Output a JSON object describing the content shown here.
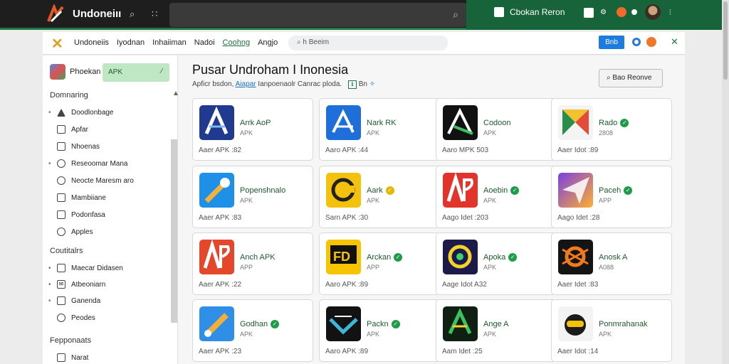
{
  "topbar": {
    "brand": "Undoneiıı",
    "search_placeholder": "",
    "ext_button": "Cbokan Reron",
    "accent": "#17643a"
  },
  "navbar": {
    "menu": [
      "Undoneiis",
      "Iyodnan",
      "Inhaiiman",
      "Nadoi",
      "Coohng",
      "Angjo"
    ],
    "active_index": 4,
    "search_placeholder": "h Beeim",
    "button": "Bnb"
  },
  "sidebar": {
    "app_name": "Phoekan",
    "apk_label": "APK",
    "sections": [
      {
        "label": "Domnaring",
        "items": [
          "Doodlonbage",
          "Apfar",
          "Nhoenas",
          "Reseoomar Mana",
          "Neocte Maresm aro",
          "Mambiiane",
          "Podonfasa",
          "Apples"
        ]
      },
      {
        "label": "Coutitalrs",
        "items": [
          "Maecar Didasen",
          "Atbeoniarn",
          "Ganenda",
          "Peodes"
        ]
      },
      {
        "label": "Fepponaats",
        "items": [
          "Narat"
        ]
      }
    ]
  },
  "main": {
    "title": "Pusar Undroham I Inonesia",
    "subtitle_text": "Apficr bsdon,",
    "subtitle_link": "Aiapar",
    "subtitle_rest": "Ianpoenaolr Canrac ploda.",
    "subtitle_icon": "Bn",
    "search_button": "Bao Reonve",
    "cards": [
      {
        "name": "Arrk AoP",
        "sub": "APK",
        "meta": "Aaer APK :82",
        "check": false,
        "icon": "a-blue"
      },
      {
        "name": "Nark RK",
        "sub": "APK",
        "meta": "Aaro APK :44",
        "check": false,
        "icon": "a-bright"
      },
      {
        "name": "Codoon",
        "sub": "APK",
        "meta": "Aaro MPK 503",
        "check": false,
        "icon": "a-black"
      },
      {
        "name": "Rado",
        "sub": "2808",
        "meta": "Aaer Idot :89",
        "check": "green",
        "icon": "x-colorful"
      },
      {
        "name": "Popenshnalo",
        "sub": "APK",
        "meta": "Aaer APK :83",
        "check": false,
        "icon": "wrench-blue"
      },
      {
        "name": "Aark",
        "sub": "APK",
        "meta": "Sarn APK :30",
        "check": "yellow",
        "icon": "c-yellow"
      },
      {
        "name": "Aoebin",
        "sub": "APK",
        "meta": "Aago Idet :203",
        "check": "green",
        "icon": "ap-red"
      },
      {
        "name": "Paceh",
        "sub": "APP",
        "meta": "Aago Idet :28",
        "check": "green",
        "icon": "paper-plane"
      },
      {
        "name": "Anch APK",
        "sub": "APP",
        "meta": "Aaer APK :22",
        "check": false,
        "icon": "ap-orange"
      },
      {
        "name": "Arckan",
        "sub": "APP",
        "meta": "Aaro APK :89",
        "check": "green",
        "icon": "fd-yellow"
      },
      {
        "name": "Apoka",
        "sub": "APK",
        "meta": "Aage Idot A32",
        "check": "green",
        "icon": "swirl-dark"
      },
      {
        "name": "Anosk A",
        "sub": "A088",
        "meta": "Aaer Idet :83",
        "check": false,
        "icon": "ox-orange"
      },
      {
        "name": "Godhan",
        "sub": "APK",
        "meta": "Aaer APK :23",
        "check": "green",
        "icon": "tool-blue"
      },
      {
        "name": "Packn",
        "sub": "APK",
        "meta": "Aaro APK :89",
        "check": "green",
        "icon": "wing-dark"
      },
      {
        "name": "Ange A",
        "sub": "APK",
        "meta": "Aam Idet :25",
        "check": false,
        "icon": "a-dark-green"
      },
      {
        "name": "Ponmrahanak",
        "sub": "APK",
        "meta": "Aaer Idot :14",
        "check": false,
        "icon": "robot"
      }
    ]
  }
}
